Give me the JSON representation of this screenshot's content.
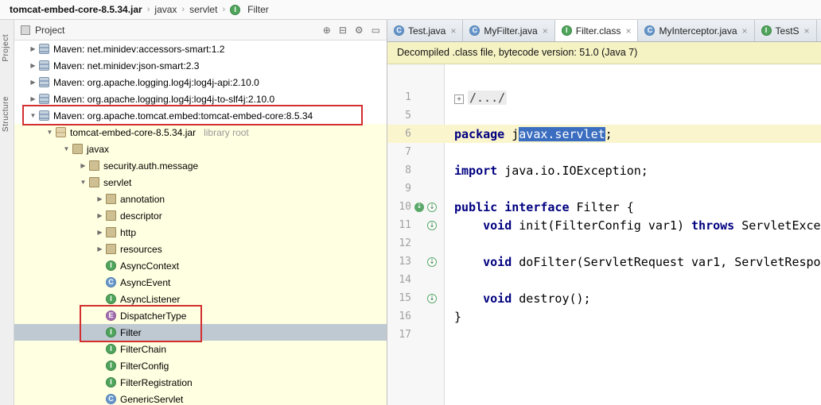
{
  "colors": {
    "annotation_red": "#D32F2F",
    "editor_selection_blue": "#3B6EC0",
    "keyword_blue": "#000080",
    "banner_yellow": "#F5F2C4",
    "library_scope_yellow": "#FFFFE1",
    "selected_row_grey": "#BFC9D2"
  },
  "breadcrumb": {
    "items": [
      {
        "label": "tomcat-embed-core-8.5.34.jar",
        "bold": true
      },
      {
        "label": "javax"
      },
      {
        "label": "servlet"
      },
      {
        "label": "Filter",
        "icon": "interface"
      }
    ]
  },
  "side_strip": {
    "tabs": [
      {
        "label": "Project"
      },
      {
        "label": "Structure"
      }
    ]
  },
  "project_panel": {
    "title": "Project",
    "toolbar": [
      {
        "name": "locate-file-icon",
        "glyph": "⊕"
      },
      {
        "name": "collapse-all-icon",
        "glyph": "⊟"
      },
      {
        "name": "settings-gear-icon",
        "glyph": "⚙"
      },
      {
        "name": "hide-panel-icon",
        "glyph": "▭"
      }
    ],
    "tree": [
      {
        "depth": 1,
        "arrow": "collapsed",
        "icon": "library",
        "label": "Maven: net.minidev:accessors-smart:1.2"
      },
      {
        "depth": 1,
        "arrow": "collapsed",
        "icon": "library",
        "label": "Maven: net.minidev:json-smart:2.3"
      },
      {
        "depth": 1,
        "arrow": "collapsed",
        "icon": "library",
        "label": "Maven: org.apache.logging.log4j:log4j-api:2.10.0"
      },
      {
        "depth": 1,
        "arrow": "collapsed",
        "icon": "library",
        "label": "Maven: org.apache.logging.log4j:log4j-to-slf4j:2.10.0"
      },
      {
        "depth": 1,
        "arrow": "expanded",
        "icon": "library",
        "label": "Maven: org.apache.tomcat.embed:tomcat-embed-core:8.5.34"
      },
      {
        "depth": 2,
        "arrow": "expanded",
        "icon": "jar",
        "label": "tomcat-embed-core-8.5.34.jar",
        "suffix": "library root",
        "scope": "library"
      },
      {
        "depth": 3,
        "arrow": "expanded",
        "icon": "package",
        "label": "javax",
        "scope": "library"
      },
      {
        "depth": 4,
        "arrow": "collapsed",
        "icon": "package",
        "label": "security.auth.message",
        "scope": "library"
      },
      {
        "depth": 4,
        "arrow": "expanded",
        "icon": "package",
        "label": "servlet",
        "scope": "library"
      },
      {
        "depth": 5,
        "arrow": "collapsed",
        "icon": "package",
        "label": "annotation",
        "scope": "library"
      },
      {
        "depth": 5,
        "arrow": "collapsed",
        "icon": "package",
        "label": "descriptor",
        "scope": "library"
      },
      {
        "depth": 5,
        "arrow": "collapsed",
        "icon": "package",
        "label": "http",
        "scope": "library"
      },
      {
        "depth": 5,
        "arrow": "collapsed",
        "icon": "package",
        "label": "resources",
        "scope": "library"
      },
      {
        "depth": 5,
        "icon": "interface",
        "label": "AsyncContext",
        "scope": "library"
      },
      {
        "depth": 5,
        "icon": "class",
        "label": "AsyncEvent",
        "scope": "library"
      },
      {
        "depth": 5,
        "icon": "interface",
        "label": "AsyncListener",
        "scope": "library"
      },
      {
        "depth": 5,
        "icon": "enum",
        "label": "DispatcherType",
        "scope": "library"
      },
      {
        "depth": 5,
        "icon": "interface",
        "label": "Filter",
        "scope": "library",
        "selected": true
      },
      {
        "depth": 5,
        "icon": "interface",
        "label": "FilterChain",
        "scope": "library"
      },
      {
        "depth": 5,
        "icon": "interface",
        "label": "FilterConfig",
        "scope": "library"
      },
      {
        "depth": 5,
        "icon": "interface",
        "label": "FilterRegistration",
        "scope": "library"
      },
      {
        "depth": 5,
        "icon": "class",
        "label": "GenericServlet",
        "scope": "library"
      }
    ]
  },
  "editor": {
    "tabs": [
      {
        "label": "Test.java",
        "icon": "class",
        "close": "×"
      },
      {
        "label": "MyFilter.java",
        "icon": "class",
        "close": "×"
      },
      {
        "label": "Filter.class",
        "icon": "interface",
        "close": "×",
        "active": true
      },
      {
        "label": "MyInterceptor.java",
        "icon": "class",
        "close": "×"
      },
      {
        "label": "TestS",
        "icon": "interface",
        "close": "×"
      }
    ],
    "banner": "Decompiled .class file, bytecode version: 51.0 (Java 7)",
    "code": [
      {
        "num": "1",
        "fold": true,
        "segments": [
          {
            "type": "fold-text",
            "text": "/.../"
          }
        ]
      },
      {
        "num": "5",
        "segments": []
      },
      {
        "num": "6",
        "current": true,
        "segments": [
          {
            "type": "keyword",
            "text": "package"
          },
          {
            "type": "plain",
            "text": " j"
          },
          {
            "type": "selection",
            "text": "avax.servlet"
          },
          {
            "type": "plain",
            "text": ";"
          }
        ]
      },
      {
        "num": "7",
        "segments": []
      },
      {
        "num": "8",
        "segments": [
          {
            "type": "keyword",
            "text": "import"
          },
          {
            "type": "plain",
            "text": " java.io.IOException;"
          }
        ]
      },
      {
        "num": "9",
        "segments": []
      },
      {
        "num": "10",
        "gutter": [
          "interface-implemented",
          "method-implemented"
        ],
        "segments": [
          {
            "type": "keyword",
            "text": "public interface"
          },
          {
            "type": "plain",
            "text": " Filter {"
          }
        ]
      },
      {
        "num": "11",
        "gutter": [
          "method-implemented"
        ],
        "segments": [
          {
            "type": "plain",
            "text": "    "
          },
          {
            "type": "keyword",
            "text": "void"
          },
          {
            "type": "plain",
            "text": " init(FilterConfig var1) "
          },
          {
            "type": "keyword",
            "text": "throws"
          },
          {
            "type": "plain",
            "text": " ServletExce"
          }
        ]
      },
      {
        "num": "12",
        "segments": []
      },
      {
        "num": "13",
        "gutter": [
          "method-implemented"
        ],
        "segments": [
          {
            "type": "plain",
            "text": "    "
          },
          {
            "type": "keyword",
            "text": "void"
          },
          {
            "type": "plain",
            "text": " doFilter(ServletRequest var1, ServletRespo"
          }
        ]
      },
      {
        "num": "14",
        "segments": []
      },
      {
        "num": "15",
        "gutter": [
          "method-implemented"
        ],
        "segments": [
          {
            "type": "plain",
            "text": "    "
          },
          {
            "type": "keyword",
            "text": "void"
          },
          {
            "type": "plain",
            "text": " destroy();"
          }
        ]
      },
      {
        "num": "16",
        "segments": [
          {
            "type": "plain",
            "text": "}"
          }
        ]
      },
      {
        "num": "17",
        "segments": []
      }
    ]
  }
}
